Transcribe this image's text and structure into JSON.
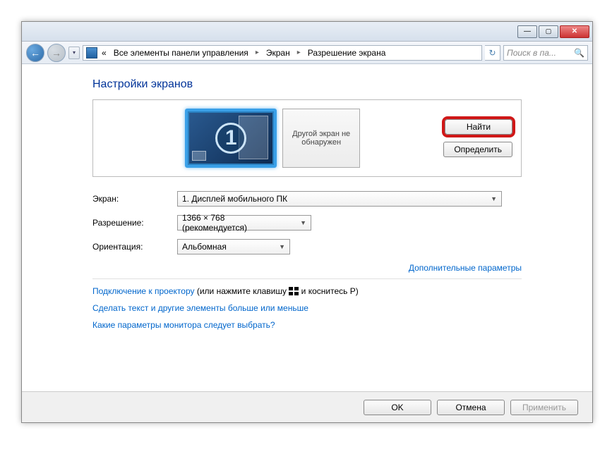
{
  "breadcrumb": {
    "root_prefix": "«",
    "root": "Все элементы панели управления",
    "level1": "Экран",
    "level2": "Разрешение экрана"
  },
  "search": {
    "placeholder": "Поиск в па..."
  },
  "page": {
    "title": "Настройки экранов"
  },
  "displays": {
    "monitor_number": "1",
    "other_text": "Другой экран не обнаружен",
    "find_btn": "Найти",
    "identify_btn": "Определить"
  },
  "form": {
    "screen_label": "Экран:",
    "screen_value": "1. Дисплей мобильного ПК",
    "resolution_label": "Разрешение:",
    "resolution_value": "1366 × 768 (рекомендуется)",
    "orientation_label": "Ориентация:",
    "orientation_value": "Альбомная"
  },
  "links": {
    "advanced": "Дополнительные параметры",
    "projector_link": "Подключение к проектору",
    "projector_suffix_a": " (или нажмите клавишу ",
    "projector_suffix_b": " и коснитесь P)",
    "text_size": "Сделать текст и другие элементы больше или меньше",
    "which_monitor": "Какие параметры монитора следует выбрать?"
  },
  "footer": {
    "ok": "OK",
    "cancel": "Отмена",
    "apply": "Применить"
  }
}
